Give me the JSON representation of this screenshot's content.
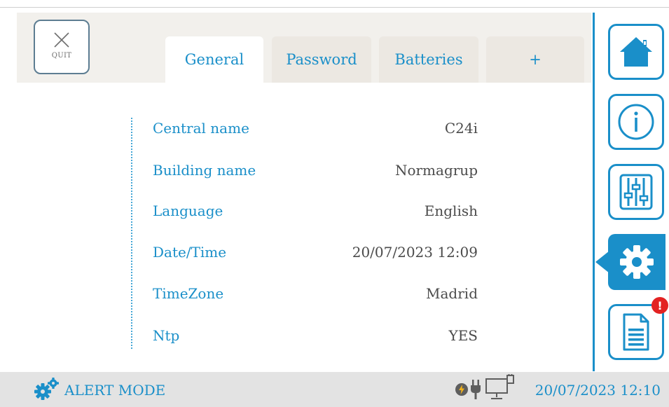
{
  "header": {
    "quit_label": "QUIT",
    "tabs": [
      {
        "label": "General",
        "active": true
      },
      {
        "label": "Password",
        "active": false
      },
      {
        "label": "Batteries",
        "active": false
      },
      {
        "label": "+",
        "active": false
      }
    ]
  },
  "settings": {
    "rows": [
      {
        "label": "Central name",
        "value": "C24i"
      },
      {
        "label": "Building name",
        "value": "Normagrup"
      },
      {
        "label": "Language",
        "value": "English"
      },
      {
        "label": "Date/Time",
        "value": "20/07/2023 12:09"
      },
      {
        "label": "TimeZone",
        "value": "Madrid"
      },
      {
        "label": "Ntp",
        "value": "YES"
      }
    ]
  },
  "sidebar": {
    "items": [
      {
        "name": "home",
        "icon": "home-icon",
        "active": false
      },
      {
        "name": "info",
        "icon": "info-icon",
        "active": false
      },
      {
        "name": "controls",
        "icon": "sliders-icon",
        "active": false
      },
      {
        "name": "settings",
        "icon": "gear-icon",
        "active": true
      },
      {
        "name": "log",
        "icon": "document-icon",
        "active": false
      }
    ],
    "log_badge": "!"
  },
  "status": {
    "mode": "ALERT MODE",
    "datetime": "20/07/2023 12:10"
  },
  "colors": {
    "accent": "#1a8fc9",
    "tab_bg": "#ece8e2",
    "status_bar_bg": "#e3e3e3",
    "alert_badge": "#e32222"
  }
}
